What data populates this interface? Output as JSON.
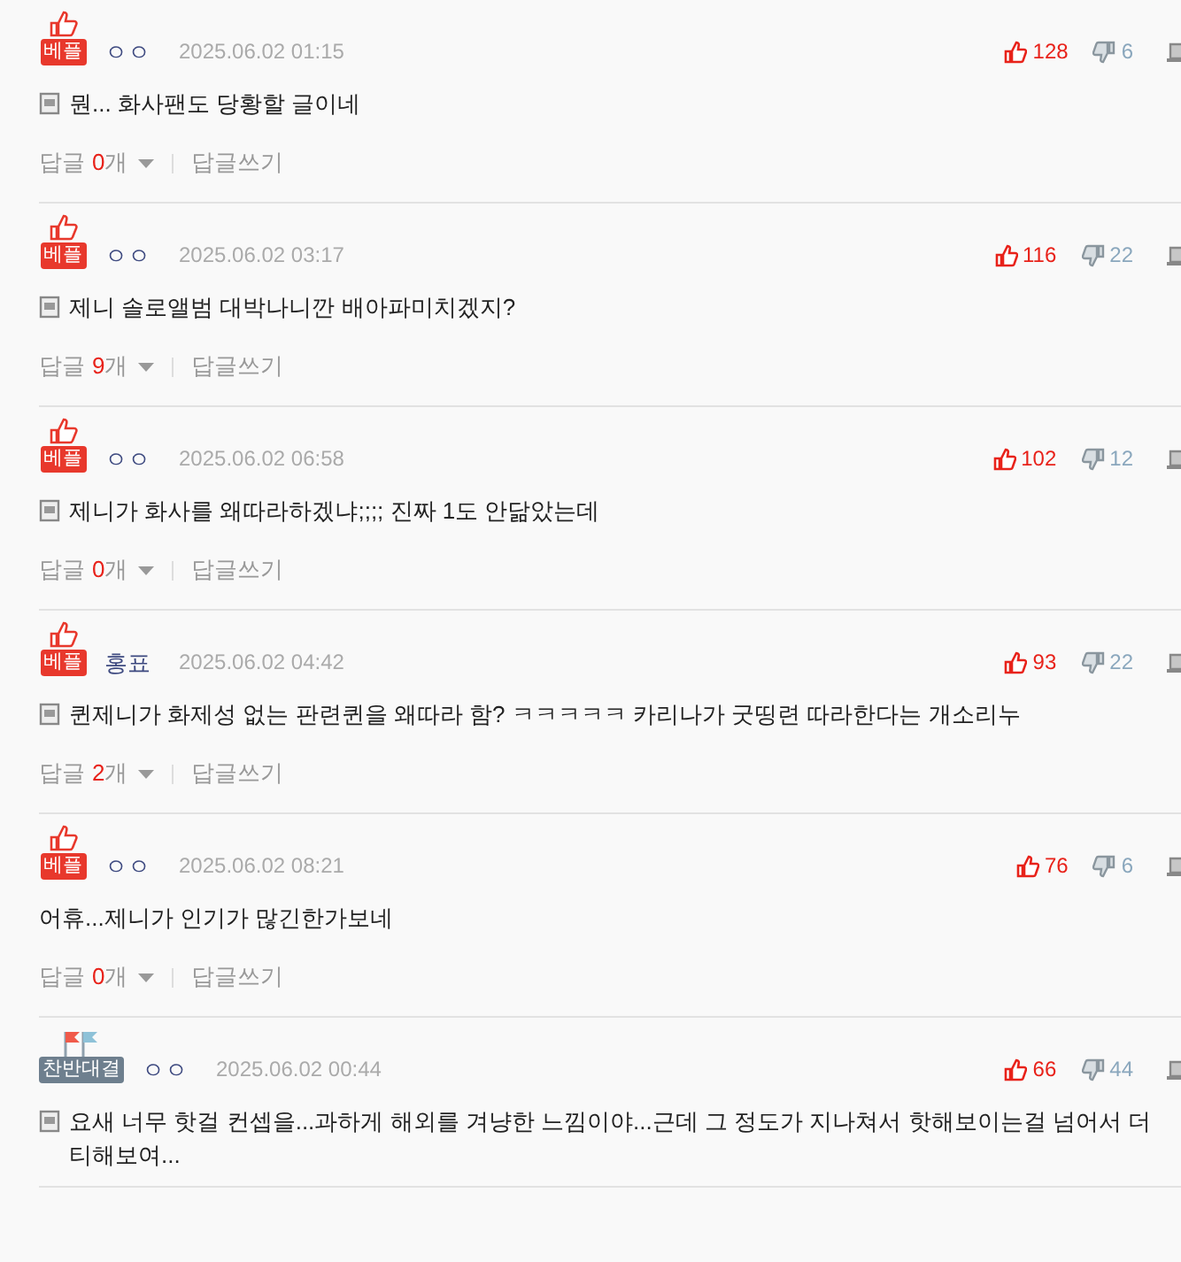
{
  "comments": [
    {
      "badge": {
        "kind": "best",
        "label": "베플"
      },
      "author": "ㅇㅇ",
      "time": "2025.06.02 01:15",
      "likes": "128",
      "dislikes": "6",
      "doc_icon": true,
      "text": "뭔... 화사팬도 당황할 글이네",
      "replies": {
        "label": "답글",
        "count": "0",
        "unit": "개",
        "write": "답글쓰기"
      }
    },
    {
      "badge": {
        "kind": "best",
        "label": "베플"
      },
      "author": "ㅇㅇ",
      "time": "2025.06.02 03:17",
      "likes": "116",
      "dislikes": "22",
      "doc_icon": true,
      "text": "제니 솔로앨범 대박나니깐 배아파미치겠지?",
      "replies": {
        "label": "답글",
        "count": "9",
        "unit": "개",
        "write": "답글쓰기"
      }
    },
    {
      "badge": {
        "kind": "best",
        "label": "베플"
      },
      "author": "ㅇㅇ",
      "time": "2025.06.02 06:58",
      "likes": "102",
      "dislikes": "12",
      "doc_icon": true,
      "text": "제니가 화사를 왜따라하겠냐;;;; 진짜 1도 안닮았는데",
      "replies": {
        "label": "답글",
        "count": "0",
        "unit": "개",
        "write": "답글쓰기"
      }
    },
    {
      "badge": {
        "kind": "best",
        "label": "베플"
      },
      "author": "홍표",
      "time": "2025.06.02 04:42",
      "likes": "93",
      "dislikes": "22",
      "doc_icon": true,
      "text": "퀸제니가 화제성 없는 판련퀸을 왜따라 함? ㅋㅋㅋㅋㅋ 카리나가 굿띵련 따라한다는 개소리누",
      "replies": {
        "label": "답글",
        "count": "2",
        "unit": "개",
        "write": "답글쓰기"
      }
    },
    {
      "badge": {
        "kind": "best",
        "label": "베플"
      },
      "author": "ㅇㅇ",
      "time": "2025.06.02 08:21",
      "likes": "76",
      "dislikes": "6",
      "doc_icon": false,
      "text": "어휴...제니가 인기가 많긴한가보네",
      "replies": {
        "label": "답글",
        "count": "0",
        "unit": "개",
        "write": "답글쓰기"
      }
    },
    {
      "badge": {
        "kind": "debate",
        "label": "찬반대결"
      },
      "author": "ㅇㅇ",
      "time": "2025.06.02 00:44",
      "likes": "66",
      "dislikes": "44",
      "doc_icon": true,
      "text": "요새 너무 핫걸 컨셉을...과하게 해외를 겨냥한 느낌이야...근데 그 정도가 지나쳐서 핫해보이는걸 넘어서 더티해보여..."
    }
  ]
}
